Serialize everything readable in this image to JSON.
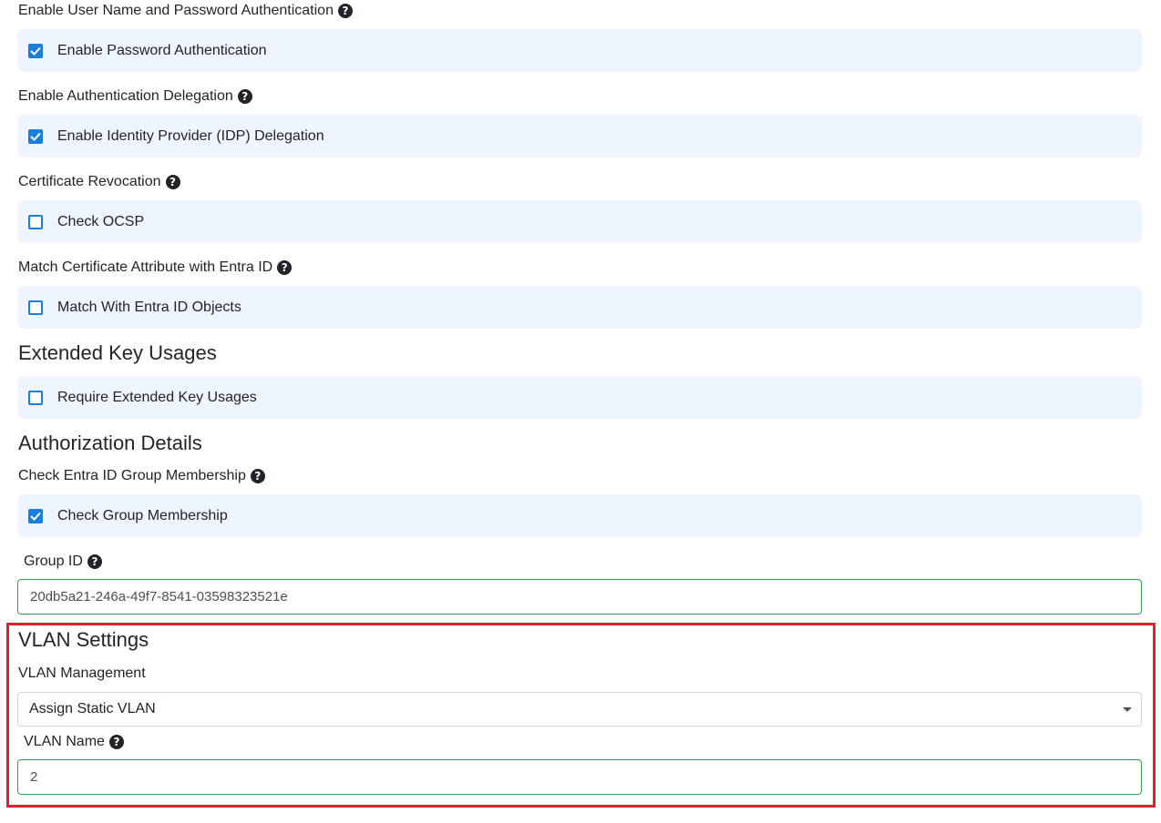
{
  "sections": {
    "auth": {
      "password_label": "Enable User Name and Password Authentication",
      "password_option": "Enable Password Authentication",
      "password_checked": true,
      "delegation_label": "Enable Authentication Delegation",
      "delegation_option": "Enable Identity Provider (IDP) Delegation",
      "delegation_checked": true,
      "revocation_label": "Certificate Revocation",
      "revocation_option": "Check OCSP",
      "revocation_checked": false,
      "match_label": "Match Certificate Attribute with Entra ID",
      "match_option": "Match With Entra ID Objects",
      "match_checked": false
    },
    "eku": {
      "title": "Extended Key Usages",
      "option": "Require Extended Key Usages",
      "checked": false
    },
    "authorization": {
      "title": "Authorization Details",
      "group_label": "Check Entra ID Group Membership",
      "group_option": "Check Group Membership",
      "group_checked": true,
      "group_id_label": "Group ID",
      "group_id_value": "20db5a21-246a-49f7-8541-03598323521e"
    },
    "vlan": {
      "title": "VLAN Settings",
      "management_label": "VLAN Management",
      "management_value": "Assign Static VLAN",
      "name_label": "VLAN Name",
      "name_value": "2"
    }
  },
  "help_glyph": "?",
  "colors": {
    "accent": "#1a7fdb",
    "option_bg": "#eef5fe",
    "valid_border": "#2e9e4f",
    "highlight": "#e0202a"
  }
}
